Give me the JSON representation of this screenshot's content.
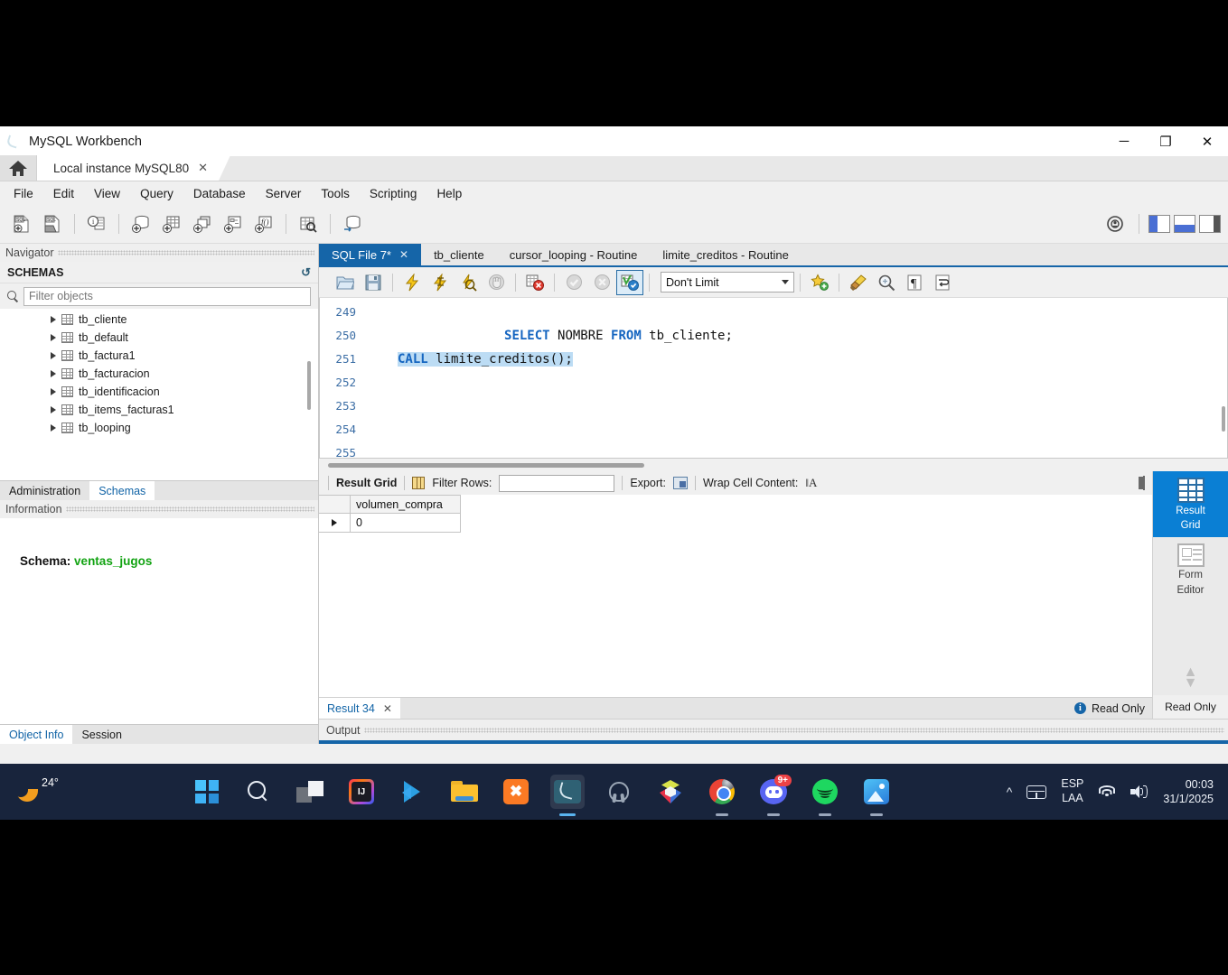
{
  "window": {
    "title": "MySQL Workbench",
    "icon": "mysql-dolphin-icon",
    "controls": {
      "minimize": "─",
      "restore": "❐",
      "close": "✕"
    }
  },
  "instance_bar": {
    "home_icon": "home-icon",
    "tab_label": "Local instance MySQL80",
    "tab_close": "✕"
  },
  "menu": {
    "items": [
      "File",
      "Edit",
      "View",
      "Query",
      "Database",
      "Server",
      "Tools",
      "Scripting",
      "Help"
    ]
  },
  "main_toolbar": {
    "buttons": [
      "new-sql-tab-icon",
      "open-sql-script-icon",
      "connection-info-icon",
      "new-schema-icon",
      "new-table-icon",
      "new-view-icon",
      "new-procedure-icon",
      "new-function-icon",
      "inspect-table-icon",
      "reconnect-server-icon"
    ],
    "right_buttons": [
      "settings-icon",
      "toggle-sidebar-icon",
      "toggle-output-icon",
      "toggle-secondary-sidebar-icon"
    ]
  },
  "navigator": {
    "panel_title": "Navigator",
    "section_title": "SCHEMAS",
    "refresh_icon": "refresh-icon",
    "search_icon": "search-icon",
    "filter_placeholder": "Filter objects",
    "filter_value": "",
    "tables": [
      "tb_cliente",
      "tb_default",
      "tb_factura1",
      "tb_facturacion",
      "tb_identificacion",
      "tb_items_facturas1",
      "tb_looping"
    ],
    "tabs": [
      {
        "label": "Administration",
        "active": false
      },
      {
        "label": "Schemas",
        "active": true
      }
    ]
  },
  "information": {
    "panel_title": "Information",
    "schema_label": "Schema:",
    "schema_name": "ventas_jugos",
    "tabs": [
      {
        "label": "Object Info",
        "active": true
      },
      {
        "label": "Session",
        "active": false
      }
    ]
  },
  "editor_tabs": [
    {
      "label": "SQL File 7*",
      "active": true,
      "closable": true
    },
    {
      "label": "tb_cliente",
      "active": false,
      "closable": false
    },
    {
      "label": "cursor_looping - Routine",
      "active": false,
      "closable": false
    },
    {
      "label": "limite_creditos - Routine",
      "active": false,
      "closable": false
    }
  ],
  "sql_toolbar": {
    "buttons": [
      "open-file-icon",
      "save-file-icon",
      "execute-icon",
      "execute-current-statement-icon",
      "explain-icon",
      "stop-icon",
      "toggle-stop-on-error-icon",
      "commit-icon",
      "rollback-icon",
      "autocommit-icon"
    ],
    "limit_value": "Don't Limit",
    "right_buttons": [
      "add-snippet-icon",
      "beautify-sql-icon",
      "find-icon",
      "show-invisible-chars-icon",
      "wrap-lines-icon"
    ]
  },
  "sql_editor": {
    "lines": [
      {
        "number": "249",
        "segments": [
          {
            "t": "SELECT",
            "c": "kw"
          },
          {
            "t": " NOMBRE ",
            "c": "id"
          },
          {
            "t": "FROM",
            "c": "kw"
          },
          {
            "t": " tb_cliente;",
            "c": "id"
          }
        ],
        "selected": false
      },
      {
        "number": "250",
        "segments": [],
        "selected": false
      },
      {
        "number": "251",
        "segments": [
          {
            "t": "CALL",
            "c": "kw"
          },
          {
            "t": " limite_creditos();",
            "c": "id"
          }
        ],
        "selected": true
      },
      {
        "number": "252",
        "segments": [],
        "selected": false
      },
      {
        "number": "253",
        "segments": [],
        "selected": false
      },
      {
        "number": "254",
        "segments": [],
        "selected": false
      },
      {
        "number": "255",
        "segments": [],
        "selected": false
      }
    ]
  },
  "result_toolbar": {
    "title": "Result Grid",
    "grid_icon": "result-grid-icon",
    "filter_label": "Filter Rows:",
    "filter_value": "",
    "export_label": "Export:",
    "export_icon": "export-recordset-icon",
    "wrap_label": "Wrap Cell Content:",
    "wrap_icon": "wrap-cell-icon",
    "panel_toggle_icon": "toggle-side-panel-icon"
  },
  "result_grid": {
    "columns": [
      "volumen_compra"
    ],
    "rows": [
      [
        "0"
      ]
    ]
  },
  "right_rail": {
    "items": [
      {
        "label": "Result\nGrid",
        "line1": "Result",
        "line2": "Grid",
        "icon": "result-grid-icon",
        "active": true
      },
      {
        "label": "Form Editor",
        "line1": "Form",
        "line2": "Editor",
        "icon": "form-editor-icon",
        "active": false
      }
    ],
    "scroll_up_icon": "chevron-up-icon",
    "scroll_down_icon": "chevron-down-icon",
    "status": "Read Only"
  },
  "bottom": {
    "result_tab": "Result 34",
    "result_tab_close": "✕",
    "info_icon": "info-icon",
    "read_only": "Read Only",
    "output_label": "Output"
  },
  "taskbar": {
    "weather_temp": "24°",
    "weather_icon": "weather-sun-icon",
    "start_icon": "windows-start-icon",
    "search_icon": "search-icon",
    "apps": [
      {
        "name": "task-view-icon",
        "running": false,
        "active": false
      },
      {
        "name": "intellij-idea-icon",
        "running": false,
        "active": false
      },
      {
        "name": "vscode-icon",
        "running": false,
        "active": false
      },
      {
        "name": "file-explorer-icon",
        "running": false,
        "active": false
      },
      {
        "name": "xampp-icon",
        "running": false,
        "active": false
      },
      {
        "name": "mysql-workbench-icon",
        "running": true,
        "active": true
      },
      {
        "name": "postgresql-icon",
        "running": false,
        "active": false
      },
      {
        "name": "3d-viewer-icon",
        "running": false,
        "active": false
      },
      {
        "name": "google-chrome-icon",
        "running": true,
        "active": false
      },
      {
        "name": "discord-icon",
        "running": true,
        "active": false,
        "badge": "9+"
      },
      {
        "name": "spotify-icon",
        "running": true,
        "active": false
      },
      {
        "name": "photos-icon",
        "running": true,
        "active": false
      }
    ],
    "tray": {
      "overflow_icon": "chevron-up-icon",
      "keyboard_icon": "keyboard-icon",
      "language_line1": "ESP",
      "language_line2": "LAA",
      "wifi_icon": "wifi-icon",
      "volume_icon": "volume-icon",
      "time": "00:03",
      "date": "31/1/2025"
    }
  }
}
